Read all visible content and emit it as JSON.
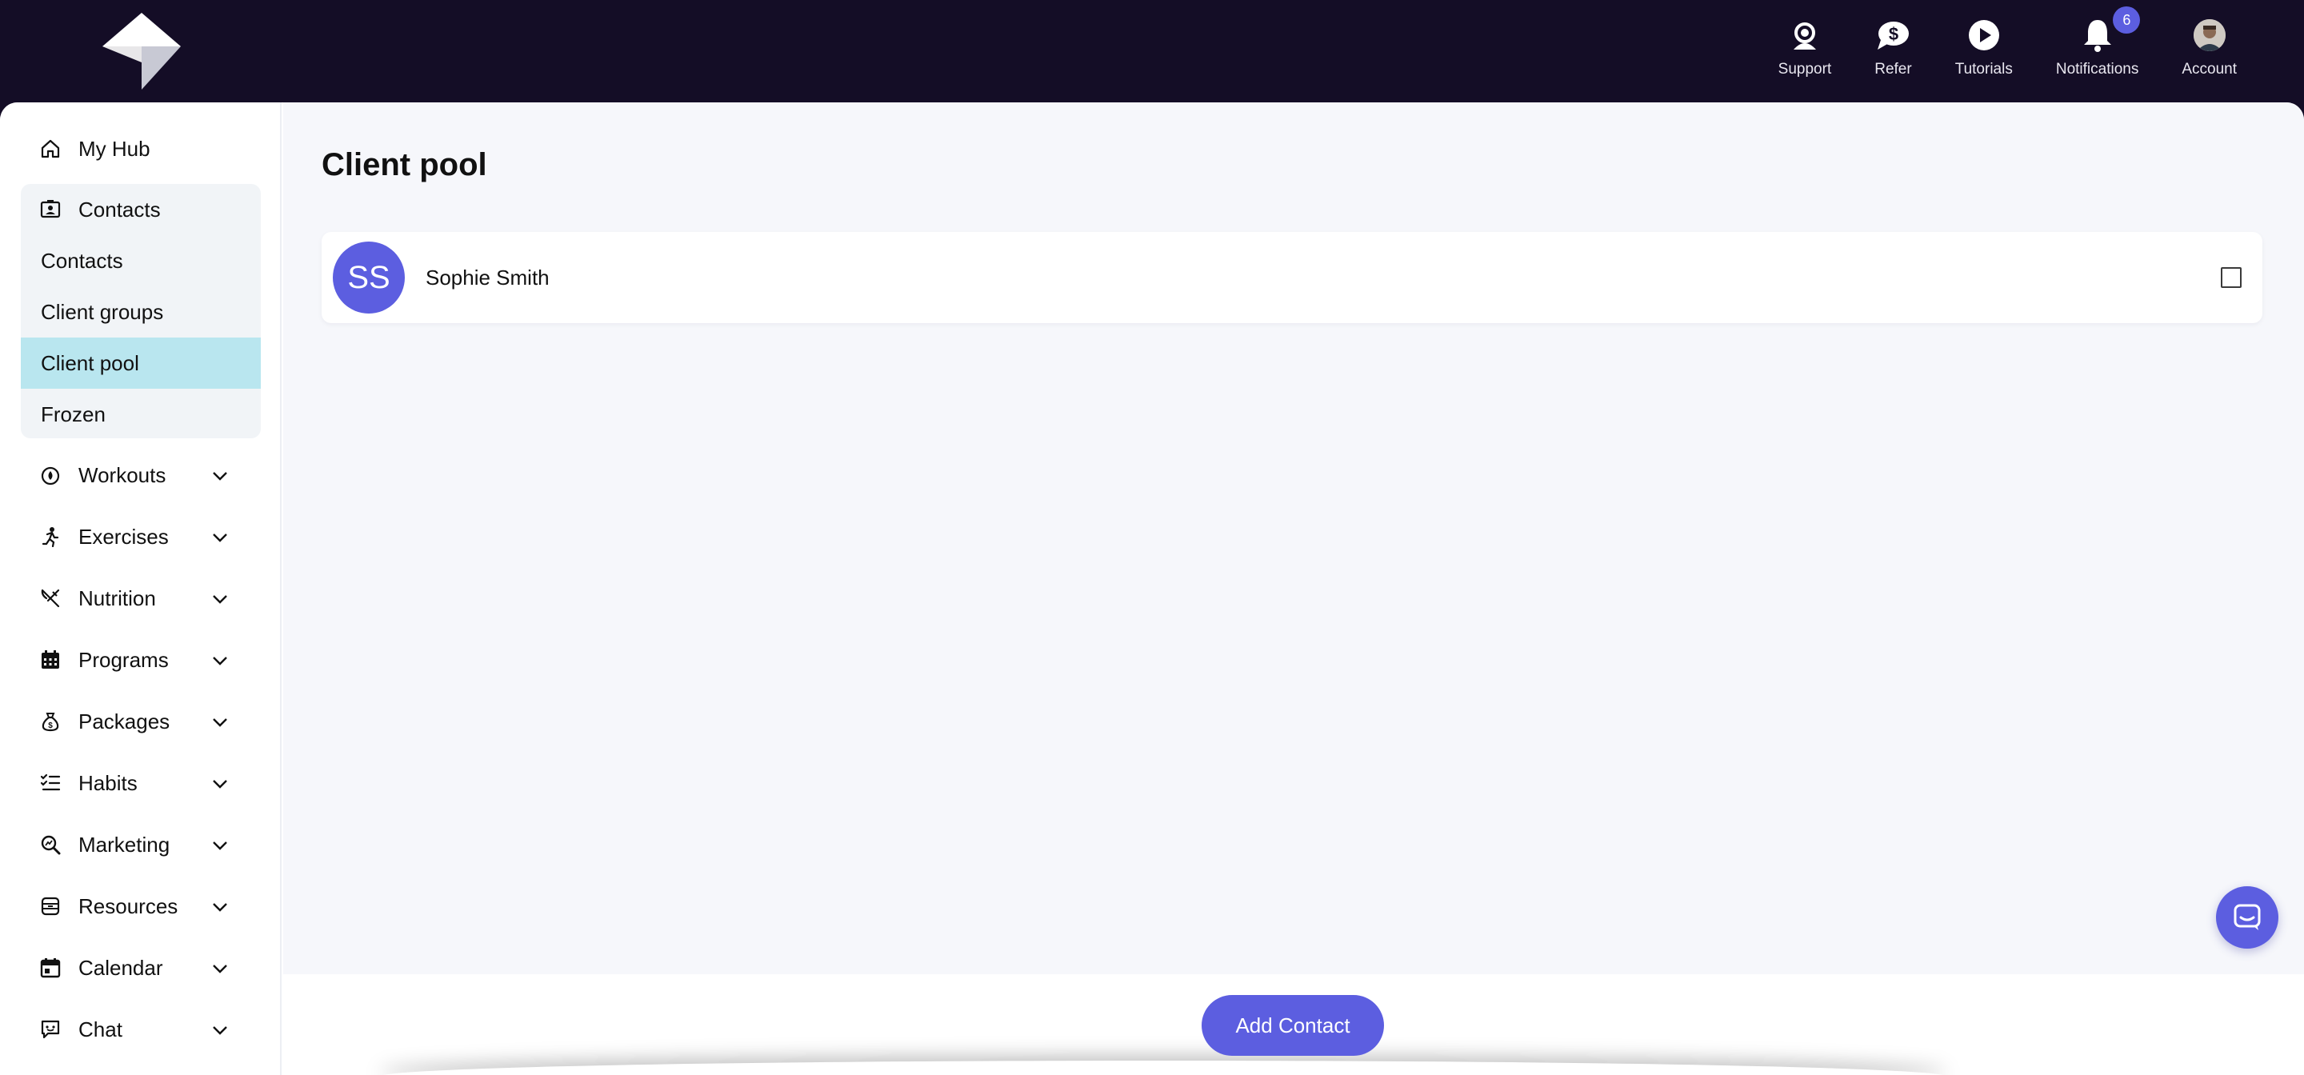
{
  "header": {
    "actions": [
      {
        "label": "Support",
        "icon": "headset-icon"
      },
      {
        "label": "Refer",
        "icon": "dollar-chat-icon"
      },
      {
        "label": "Tutorials",
        "icon": "play-icon"
      },
      {
        "label": "Notifications",
        "icon": "bell-icon",
        "badge": "6"
      },
      {
        "label": "Account",
        "icon": "avatar"
      }
    ]
  },
  "sidebar": {
    "my_hub": "My Hub",
    "contacts": {
      "label": "Contacts",
      "sub": [
        "Contacts",
        "Client groups",
        "Client pool",
        "Frozen"
      ],
      "active": "Client pool"
    },
    "items": [
      {
        "label": "Workouts",
        "icon": "workout-icon"
      },
      {
        "label": "Exercises",
        "icon": "running-icon"
      },
      {
        "label": "Nutrition",
        "icon": "utensils-icon"
      },
      {
        "label": "Programs",
        "icon": "calendar-grid-icon"
      },
      {
        "label": "Packages",
        "icon": "money-bag-icon"
      },
      {
        "label": "Habits",
        "icon": "checklist-icon"
      },
      {
        "label": "Marketing",
        "icon": "magnify-icon"
      },
      {
        "label": "Resources",
        "icon": "archive-icon"
      },
      {
        "label": "Calendar",
        "icon": "calendar-icon"
      },
      {
        "label": "Chat",
        "icon": "chat-icon"
      }
    ]
  },
  "main": {
    "title": "Client pool",
    "clients": [
      {
        "initials": "SS",
        "name": "Sophie Smith",
        "checked": false
      }
    ]
  },
  "footer": {
    "add_label": "Add Contact"
  },
  "colors": {
    "topbar": "#140d26",
    "accent": "#5c5ee0",
    "active_nav": "#b9e6ef"
  }
}
